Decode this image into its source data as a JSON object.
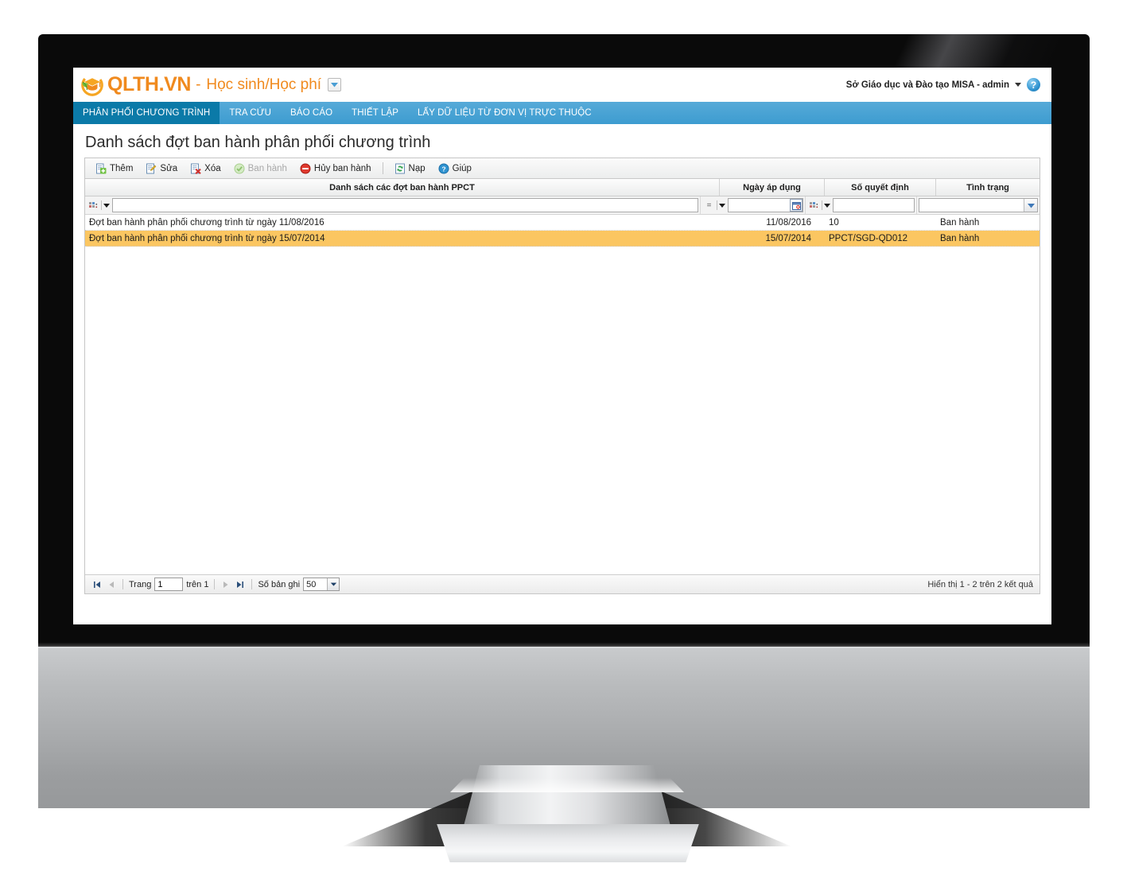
{
  "header": {
    "logo_icon": "graduation-cap-leaf-logo",
    "brand": "QLTH.VN",
    "dash": "-",
    "module": "Học sinh/Học phí",
    "module_dropdown_icon": "chevron-down-icon",
    "user": "Sở Giáo dục và Đào tạo MISA - admin",
    "user_caret_icon": "caret-down-icon",
    "help_icon": "question-mark-icon",
    "help_label": "?"
  },
  "nav": {
    "items": [
      {
        "label": "PHÂN PHỐI CHƯƠNG TRÌNH",
        "active": true
      },
      {
        "label": "TRA CỨU",
        "active": false
      },
      {
        "label": "BÁO CÁO",
        "active": false
      },
      {
        "label": "THIẾT LẬP",
        "active": false
      },
      {
        "label": "LẤY DỮ LIỆU TỪ ĐƠN VỊ TRỰC THUỘC",
        "active": false
      }
    ]
  },
  "page": {
    "title": "Danh sách đợt ban hành phân phối chương trình"
  },
  "toolbar": {
    "buttons": [
      {
        "label": "Thêm",
        "icon": "add-document-icon",
        "disabled": false
      },
      {
        "label": "Sửa",
        "icon": "edit-pencil-icon",
        "disabled": false
      },
      {
        "label": "Xóa",
        "icon": "delete-document-icon",
        "disabled": false
      },
      {
        "label": "Ban hành",
        "icon": "check-circle-icon",
        "disabled": true
      },
      {
        "label": "Hủy ban hành",
        "icon": "cancel-circle-icon",
        "disabled": false
      },
      {
        "label": "Nạp",
        "icon": "refresh-icon",
        "disabled": false
      },
      {
        "label": "Giúp",
        "icon": "help-circle-icon",
        "disabled": false
      }
    ]
  },
  "grid": {
    "columns": [
      {
        "label": "Danh sách các đợt ban hành PPCT",
        "key": "name"
      },
      {
        "label": "Ngày áp dụng",
        "key": "date"
      },
      {
        "label": "Số quyết định",
        "key": "decision"
      },
      {
        "label": "Tình trạng",
        "key": "status"
      }
    ],
    "filters": {
      "name": {
        "operator": "*",
        "value": "",
        "placeholder": ""
      },
      "date": {
        "operator": "=",
        "value": "",
        "placeholder": "",
        "calendar_icon": "calendar-icon"
      },
      "decision": {
        "operator": "*",
        "value": "",
        "placeholder": ""
      },
      "status": {
        "value": "",
        "dropdown_icon": "chevron-down-icon"
      }
    },
    "rows": [
      {
        "name": "Đợt ban hành phân phối chương trình từ ngày 11/08/2016",
        "date": "11/08/2016",
        "decision": "10",
        "status": "Ban hành",
        "selected": false
      },
      {
        "name": "Đợt ban hành phân phối chương trình từ ngày 15/07/2014",
        "date": "15/07/2014",
        "decision": "PPCT/SGD-QD012",
        "status": "Ban hành",
        "selected": true
      }
    ]
  },
  "pager": {
    "first_icon": "first-page-icon",
    "prev_icon": "prev-page-icon",
    "next_icon": "next-page-icon",
    "last_icon": "last-page-icon",
    "page_label": "Trang",
    "page_value": "1",
    "of_label": "trên 1",
    "records_label": "Số bản ghi",
    "records_value": "50",
    "records_arrow_icon": "chevron-down-icon",
    "summary": "Hiển thị 1 - 2 trên 2 kết quả"
  },
  "colors": {
    "brand_orange": "#f08a1e",
    "nav_blue": "#3d9cd0",
    "nav_active_blue": "#0b7aa8",
    "row_selected": "#fbc661"
  }
}
